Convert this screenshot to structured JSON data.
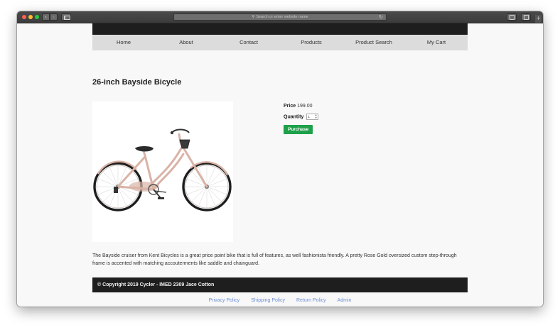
{
  "browser": {
    "url_placeholder": "Search or enter website name",
    "icons": {
      "back": "chevron-left-icon",
      "forward": "chevron-right-icon",
      "sidebar": "sidebar-icon",
      "search": "search-icon",
      "reload": "reload-icon",
      "share": "share-icon",
      "tabs": "tabs-icon",
      "new_tab": "plus-icon"
    }
  },
  "nav": {
    "items": [
      "Home",
      "About",
      "Contact",
      "Products",
      "Product Search",
      "My Cart"
    ]
  },
  "product": {
    "title": "26-inch Bayside Bicycle",
    "price_label": "Price",
    "price_value": "199.00",
    "quantity_label": "Quantity",
    "quantity_value": "1",
    "purchase_label": "Purchase",
    "description": "The Bayside cruiser from Kent Bicycles is a great price point bike that is full of features, as well fashionista friendly. A pretty Rose Gold oversized custom step-through frame is accented with matching accouterments like saddle and chainguard."
  },
  "footer": {
    "copyright": "© Copyright 2019 Cycler - IMED 2309 Jace Cotton",
    "links": [
      "Privacy Policy",
      "Shipping Policy",
      "Return Policy",
      "Admin"
    ]
  },
  "colors": {
    "topbar": "#1e1e1e",
    "navbar": "#dcdcdc",
    "purchase_button": "#1fa04a",
    "link": "#6d8fd6",
    "bike_frame": "#d9b3a6"
  }
}
